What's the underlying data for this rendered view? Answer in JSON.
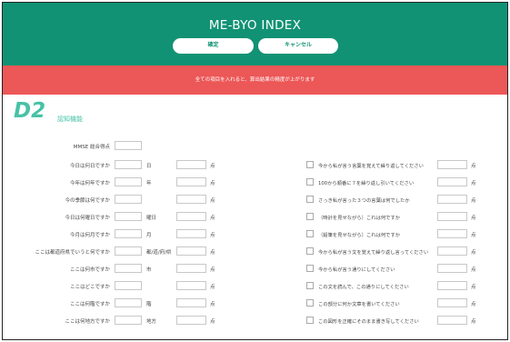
{
  "app": {
    "title": "ME-BYO INDEX",
    "confirm_label": "確定",
    "cancel_label": "キャンセル",
    "banner": "全ての項目を入れると、算出結果の精度が上がります"
  },
  "section": {
    "code": "D2",
    "name": "認知機能"
  },
  "mmse": {
    "label": "MMSE 総合得点"
  },
  "left_rows": [
    {
      "label": "今日は何日ですか",
      "unit": "日",
      "score_unit": "点"
    },
    {
      "label": "今年は何年ですか",
      "unit": "年",
      "score_unit": "点"
    },
    {
      "label": "今の季節は何ですか",
      "unit": "",
      "score_unit": "点"
    },
    {
      "label": "今日は何曜日ですか",
      "unit": "曜日",
      "score_unit": "点"
    },
    {
      "label": "今月は何月ですか",
      "unit": "月",
      "score_unit": "点"
    },
    {
      "label": "ここは都道府県でいうと何ですか",
      "unit": "都/道/府/県",
      "score_unit": "点"
    },
    {
      "label": "ここは何市ですか",
      "unit": "市",
      "score_unit": "点"
    },
    {
      "label": "ここはどこですか",
      "unit": "",
      "score_unit": "点"
    },
    {
      "label": "ここは何階ですか",
      "unit": "階",
      "score_unit": "点"
    },
    {
      "label": "ここは何地方ですか",
      "unit": "地方",
      "score_unit": "点"
    }
  ],
  "right_rows": [
    {
      "text": "今から私が言う言葉を覚えて繰り返してください",
      "score_unit": "点"
    },
    {
      "text": "100から順番に７を繰り返し引いてください",
      "score_unit": "点"
    },
    {
      "text": "さっき私が言った３つの言葉は何でしたか",
      "score_unit": "点"
    },
    {
      "text": "（時計を見せながら）これは何ですか",
      "score_unit": "点"
    },
    {
      "text": "（鉛筆を見せながら）これは何ですか",
      "score_unit": "点"
    },
    {
      "text": "今から私が言う文を覚えて繰り返し言ってください",
      "score_unit": "点"
    },
    {
      "text": "今から私が言う通りにしてください",
      "score_unit": "点"
    },
    {
      "text": "この文を読んで、この通りにしてください",
      "score_unit": "点"
    },
    {
      "text": "この部分に何か文章を書いてください",
      "score_unit": "点"
    },
    {
      "text": "この図形を正確にそのまま書き写してください",
      "score_unit": "点"
    }
  ]
}
